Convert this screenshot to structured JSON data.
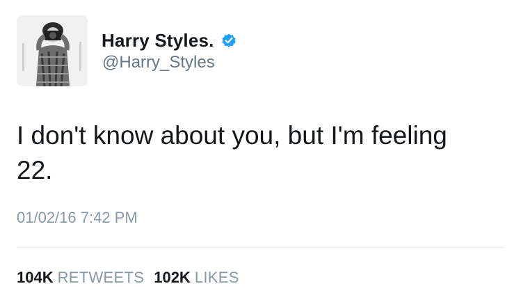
{
  "author": {
    "display_name": "Harry Styles.",
    "handle": "@Harry_Styles",
    "verified": true,
    "verified_color": "#1da1f2",
    "avatar_icon": "profile-photo-monochrome"
  },
  "tweet": {
    "text": "I don't know about you, but I'm feeling\n22.",
    "timestamp": "01/02/16 7:42 PM"
  },
  "stats": {
    "retweets_count": "104K",
    "retweets_label": "RETWEETS",
    "likes_count": "102K",
    "likes_label": "LIKES"
  },
  "colors": {
    "text_primary": "#14171a",
    "text_secondary": "#8899a6",
    "divider": "#e1e8ed"
  }
}
